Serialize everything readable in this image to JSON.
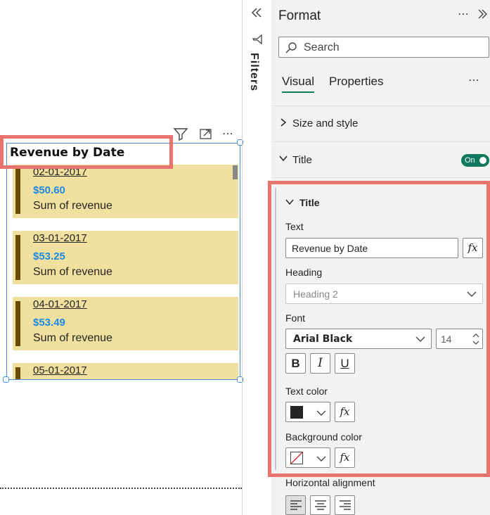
{
  "format_pane": {
    "header": "Format",
    "search_placeholder": "Search",
    "tabs": [
      "Visual",
      "Properties"
    ],
    "sections": {
      "size_and_style": "Size and style",
      "title": "Title",
      "title_toggle": "On",
      "title_subsection": "Title"
    },
    "text_label": "Text",
    "text_value": "Revenue by Date",
    "heading_label": "Heading",
    "heading_value": "Heading 2",
    "font_label": "Font",
    "font_value": "Arial Black",
    "font_size": "14",
    "bold": "B",
    "italic": "I",
    "underline": "U",
    "text_color_label": "Text color",
    "text_color": "#252423",
    "background_color_label": "Background color",
    "horizontal_alignment_label": "Horizontal alignment",
    "fx": "fx"
  },
  "filters_label": "Filters",
  "visual": {
    "title": "Revenue by Date",
    "cards": [
      {
        "date": "02-01-2017",
        "value": "$50.60",
        "label": "Sum of revenue"
      },
      {
        "date": "03-01-2017",
        "value": "$53.25",
        "label": "Sum of revenue"
      },
      {
        "date": "04-01-2017",
        "value": "$53.49",
        "label": "Sum of revenue"
      },
      {
        "date": "05-01-2017",
        "value": "",
        "label": ""
      }
    ]
  },
  "colors": {
    "card_bg": "#f0e09f",
    "card_accent": "#6a4c00",
    "value_blue": "#1c8ae6",
    "highlight": "#e8736f",
    "toggle_on": "#127a5c"
  }
}
